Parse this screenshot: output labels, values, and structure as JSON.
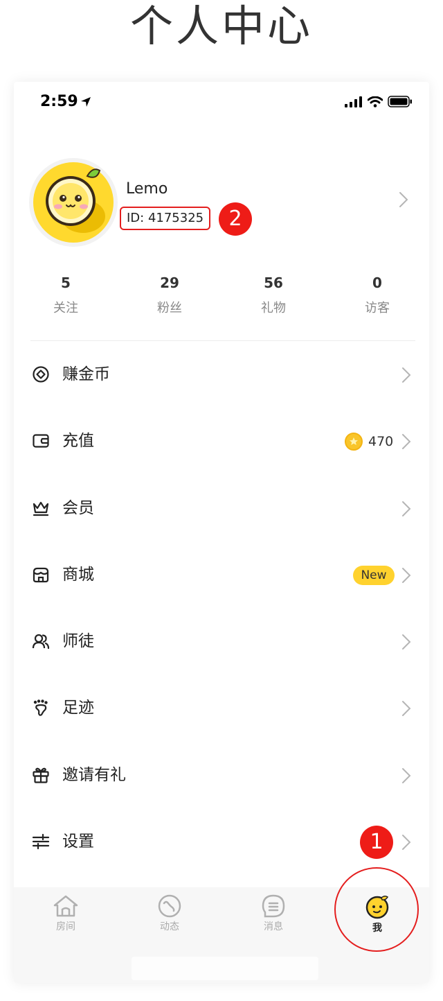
{
  "page_heading": "个人中心",
  "status_bar": {
    "time": "2:59"
  },
  "profile": {
    "username": "Lemo",
    "user_id": "ID: 4175325",
    "annotation_badge": "2"
  },
  "stats": [
    {
      "value": "5",
      "label": "关注"
    },
    {
      "value": "29",
      "label": "粉丝"
    },
    {
      "value": "56",
      "label": "礼物"
    },
    {
      "value": "0",
      "label": "访客"
    }
  ],
  "menu": [
    {
      "label": "赚金币",
      "icon": "earn-coins-icon"
    },
    {
      "label": "充值",
      "icon": "wallet-icon",
      "coin_balance": "470"
    },
    {
      "label": "会员",
      "icon": "crown-icon"
    },
    {
      "label": "商城",
      "icon": "store-icon",
      "badge": "New"
    },
    {
      "label": "师徒",
      "icon": "people-icon"
    },
    {
      "label": "足迹",
      "icon": "footprint-icon"
    },
    {
      "label": "邀请有礼",
      "icon": "gift-icon"
    },
    {
      "label": "设置",
      "icon": "sliders-icon",
      "annotation_badge": "1"
    }
  ],
  "tabbar": [
    {
      "label": "房间",
      "icon": "home-icon",
      "active": false
    },
    {
      "label": "动态",
      "icon": "feed-icon",
      "active": false
    },
    {
      "label": "消息",
      "icon": "message-icon",
      "active": false
    },
    {
      "label": "我",
      "icon": "lemon-face-icon",
      "active": true
    }
  ],
  "colors": {
    "accent_yellow": "#ffd22e",
    "annotation_red": "#e41e1e",
    "text_primary": "#222222",
    "text_secondary": "#888888"
  }
}
